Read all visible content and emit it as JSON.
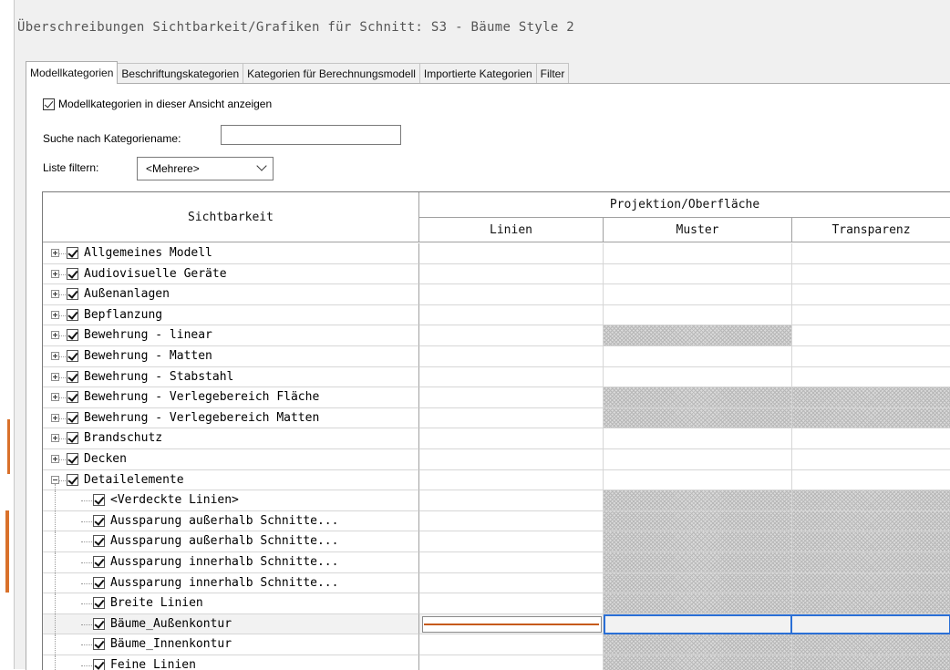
{
  "window_title": "Überschreibungen Sichtbarkeit/Grafiken für Schnitt: S3 - Bäume Style 2",
  "tabs": [
    {
      "label": "Modellkategorien",
      "active": true
    },
    {
      "label": "Beschriftungskategorien",
      "active": false
    },
    {
      "label": "Kategorien für Berechnungsmodell",
      "active": false
    },
    {
      "label": "Importierte Kategorien",
      "active": false
    },
    {
      "label": "Filter",
      "active": false
    }
  ],
  "show_model_categories": {
    "label": "Modellkategorien in dieser Ansicht anzeigen",
    "checked": true
  },
  "search": {
    "label": "Suche nach Kategoriename:",
    "value": ""
  },
  "filter_list": {
    "label": "Liste filtern:",
    "selected": "<Mehrere>"
  },
  "grid": {
    "header_visibility": "Sichtbarkeit",
    "header_group": "Projektion/Oberfläche",
    "header_lines": "Linien",
    "header_pattern": "Muster",
    "header_transparency": "Transparenz",
    "rows": [
      {
        "label": "Allgemeines Modell",
        "level": 0,
        "expander": "plus",
        "checked": true,
        "pattern_hatched": false,
        "transparency_hatched": false
      },
      {
        "label": "Audiovisuelle Geräte",
        "level": 0,
        "expander": "plus",
        "checked": true,
        "pattern_hatched": false,
        "transparency_hatched": false
      },
      {
        "label": "Außenanlagen",
        "level": 0,
        "expander": "plus",
        "checked": true,
        "pattern_hatched": false,
        "transparency_hatched": false
      },
      {
        "label": "Bepflanzung",
        "level": 0,
        "expander": "plus",
        "checked": true,
        "pattern_hatched": false,
        "transparency_hatched": false
      },
      {
        "label": "Bewehrung - linear",
        "level": 0,
        "expander": "plus",
        "checked": true,
        "pattern_hatched": true,
        "transparency_hatched": false
      },
      {
        "label": "Bewehrung - Matten",
        "level": 0,
        "expander": "plus",
        "checked": true,
        "pattern_hatched": false,
        "transparency_hatched": false
      },
      {
        "label": "Bewehrung - Stabstahl",
        "level": 0,
        "expander": "plus",
        "checked": true,
        "pattern_hatched": false,
        "transparency_hatched": false
      },
      {
        "label": "Bewehrung - Verlegebereich Fläche",
        "level": 0,
        "expander": "plus",
        "checked": true,
        "pattern_hatched": true,
        "transparency_hatched": true
      },
      {
        "label": "Bewehrung - Verlegebereich Matten",
        "level": 0,
        "expander": "plus",
        "checked": true,
        "pattern_hatched": true,
        "transparency_hatched": true
      },
      {
        "label": "Brandschutz",
        "level": 0,
        "expander": "plus",
        "checked": true,
        "pattern_hatched": false,
        "transparency_hatched": false
      },
      {
        "label": "Decken",
        "level": 0,
        "expander": "plus",
        "checked": true,
        "pattern_hatched": false,
        "transparency_hatched": false
      },
      {
        "label": "Detailelemente",
        "level": 0,
        "expander": "minus",
        "checked": true,
        "pattern_hatched": false,
        "transparency_hatched": false
      },
      {
        "label": "<Verdeckte Linien>",
        "level": 1,
        "expander": "none",
        "checked": true,
        "pattern_hatched": true,
        "transparency_hatched": true
      },
      {
        "label": "Aussparung außerhalb Schnitte...",
        "level": 1,
        "expander": "none",
        "checked": true,
        "pattern_hatched": true,
        "transparency_hatched": true
      },
      {
        "label": "Aussparung außerhalb Schnitte...",
        "level": 1,
        "expander": "none",
        "checked": true,
        "pattern_hatched": true,
        "transparency_hatched": true
      },
      {
        "label": "Aussparung innerhalb Schnitte...",
        "level": 1,
        "expander": "none",
        "checked": true,
        "pattern_hatched": true,
        "transparency_hatched": true
      },
      {
        "label": "Aussparung innerhalb Schnitte...",
        "level": 1,
        "expander": "none",
        "checked": true,
        "pattern_hatched": true,
        "transparency_hatched": true
      },
      {
        "label": "Breite Linien",
        "level": 1,
        "expander": "none",
        "checked": true,
        "pattern_hatched": true,
        "transparency_hatched": true
      },
      {
        "label": "Bäume_Außenkontur",
        "level": 1,
        "expander": "none",
        "checked": true,
        "pattern_hatched": false,
        "transparency_hatched": false,
        "selected": true
      },
      {
        "label": "Bäume_Innenkontur",
        "level": 1,
        "expander": "none",
        "checked": true,
        "pattern_hatched": true,
        "transparency_hatched": true
      },
      {
        "label": "Feine Linien",
        "level": 1,
        "expander": "none",
        "checked": true,
        "pattern_hatched": true,
        "transparency_hatched": true
      }
    ]
  },
  "colors": {
    "accent_selection": "#2a6fd6",
    "line_override": "#c65a1a",
    "background_drawing": "#d9712b"
  }
}
